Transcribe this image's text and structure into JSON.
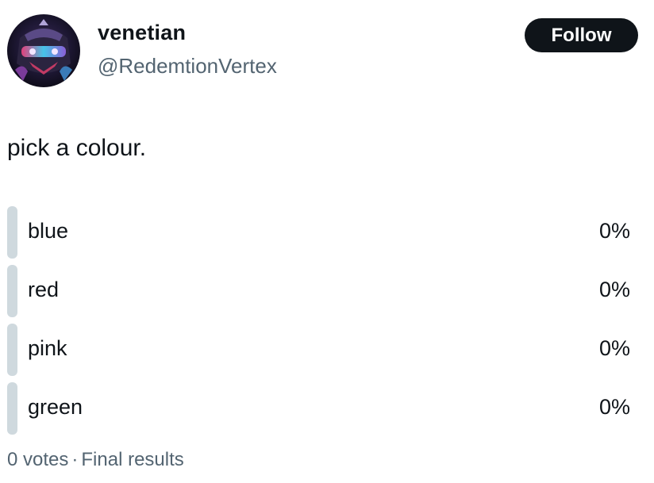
{
  "author": {
    "display_name": "venetian",
    "handle": "@RedemtionVertex",
    "avatar_icon": "robot-mask-avatar"
  },
  "follow_button": {
    "label": "Follow"
  },
  "post": {
    "text": "pick a colour."
  },
  "poll": {
    "options": [
      {
        "label": "blue",
        "percent_label": "0%",
        "percent": 0
      },
      {
        "label": "red",
        "percent_label": "0%",
        "percent": 0
      },
      {
        "label": "pink",
        "percent_label": "0%",
        "percent": 0
      },
      {
        "label": "green",
        "percent_label": "0%",
        "percent": 0
      }
    ],
    "votes": "0 votes",
    "separator": "·",
    "status": "Final results"
  },
  "colors": {
    "text_primary": "#0f1419",
    "text_secondary": "#536471",
    "poll_bar": "#cfd9de",
    "button_bg": "#0f1419",
    "button_text": "#ffffff"
  }
}
